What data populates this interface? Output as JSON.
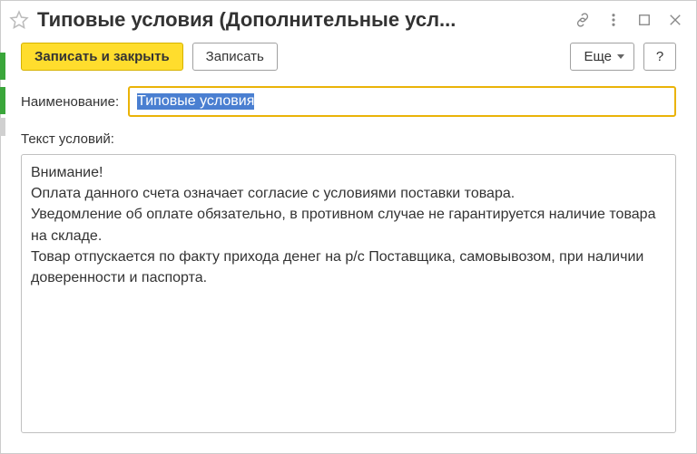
{
  "titlebar": {
    "title": "Типовые условия (Дополнительные усл..."
  },
  "toolbar": {
    "save_close": "Записать и закрыть",
    "save": "Записать",
    "more": "Еще",
    "help": "?"
  },
  "form": {
    "name_label": "Наименование:",
    "name_value": "Типовые условия",
    "terms_label": "Текст условий:",
    "terms_value": "Внимание!\nОплата данного счета означает согласие с условиями поставки товара.\nУведомление об оплате обязательно, в противном случае не гарантируется наличие товара на складе.\nТовар отпускается по факту прихода денег на р/с Поставщика, самовывозом, при наличии доверенности и паспорта."
  }
}
